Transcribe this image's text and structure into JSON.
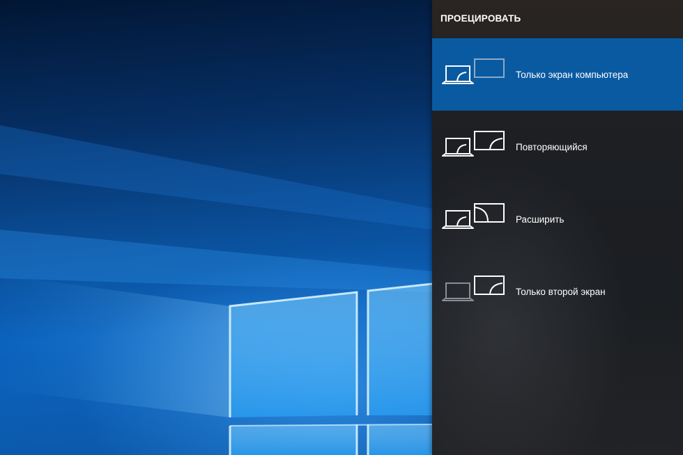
{
  "panel": {
    "title": "ПРОЕЦИРОВАТЬ",
    "options": [
      {
        "label": "Только экран компьютера",
        "icon": "pc-screen-only-icon",
        "selected": true
      },
      {
        "label": "Повторяющийся",
        "icon": "duplicate-icon",
        "selected": false
      },
      {
        "label": "Расширить",
        "icon": "extend-icon",
        "selected": false
      },
      {
        "label": "Только второй экран",
        "icon": "second-screen-only-icon",
        "selected": false
      }
    ]
  },
  "colors": {
    "selected_background": "#0a5aa2",
    "panel_background": "#1d1f23",
    "text": "#ffffff",
    "dimmed_icon": "#8a8f95",
    "wallpaper_blue": "#0c63bd"
  }
}
